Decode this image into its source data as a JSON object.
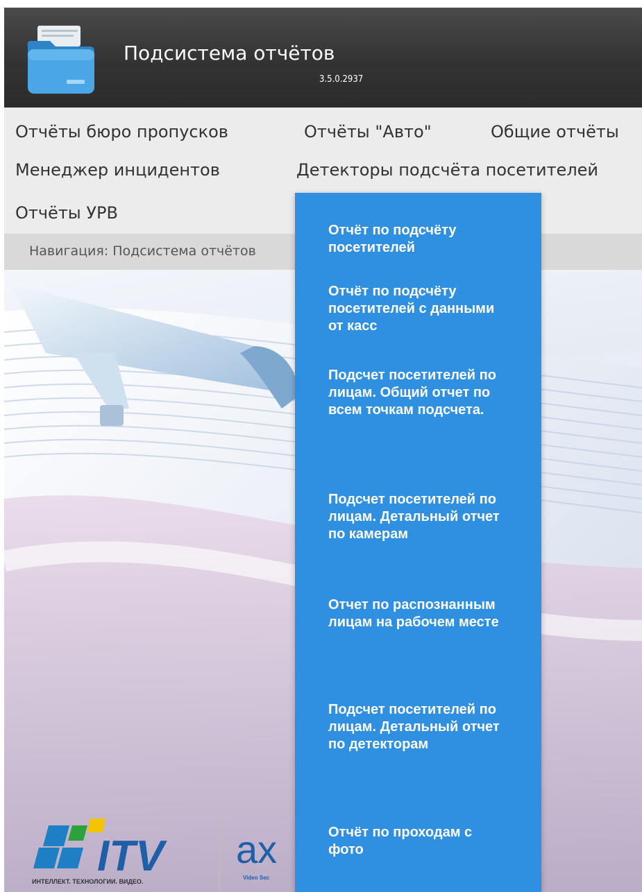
{
  "header": {
    "title": "Подсистема отчётов",
    "version": "3.5.0.2937",
    "icon": "folder-icon"
  },
  "menu": {
    "items": [
      "Отчёты бюро пропусков",
      "Отчёты \"Авто\"",
      "Общие отчёты",
      "Менеджер инцидентов",
      "Детекторы подсчёта посетителей",
      "Отчёты УРВ"
    ]
  },
  "navigation": {
    "text": "Навигация: Подсистема отчётов"
  },
  "dropdown": {
    "items": [
      "Отчёт по подсчёту посетителей",
      "Отчёт по подсчёту посетителей с данными от касс",
      "Подсчет посетителей по лицам. Общий отчет по всем точкам подсчета.",
      "Подсчет посетителей по лицам. Детальный отчет по камерам",
      "Отчет по распознанным лицам на рабочем месте",
      "Подсчет посетителей по лицам. Детальный отчет по детекторам",
      "Отчёт по проходам с фото"
    ]
  },
  "logos": {
    "itv_text": "ITV",
    "itv_tagline": "ИНТЕЛЛЕКТ. ТЕХНОЛОГИИ. ВИДЕО.",
    "axxon_text": "ax",
    "axxon_tagline": "Video Sec"
  },
  "colors": {
    "header_bg": "#333333",
    "menu_bg": "#ececec",
    "nav_bg": "#d9d9d9",
    "dropdown_bg": "#2f8fe0",
    "dropdown_text": "#ffffff"
  }
}
